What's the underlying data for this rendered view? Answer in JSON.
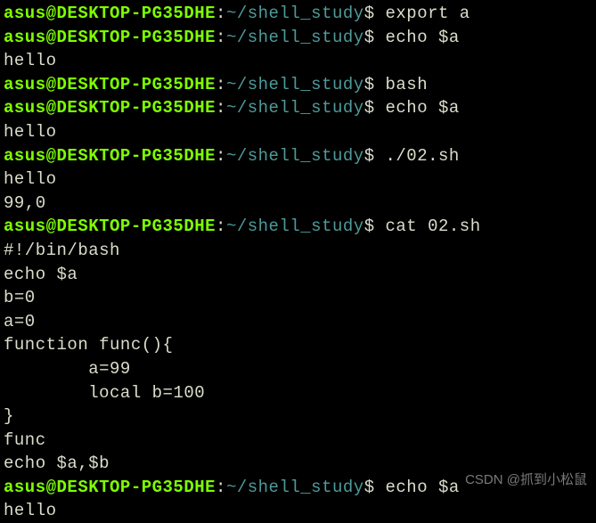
{
  "prompt": {
    "user_host": "asus@DESKTOP-PG35DHE",
    "colon": ":",
    "path": "~/shell_study",
    "dollar": "$"
  },
  "lines": [
    {
      "type": "prompt",
      "cmd": "export a"
    },
    {
      "type": "prompt",
      "cmd": "echo $a"
    },
    {
      "type": "output",
      "text": "hello"
    },
    {
      "type": "prompt",
      "cmd": "bash"
    },
    {
      "type": "prompt",
      "cmd": "echo $a"
    },
    {
      "type": "output",
      "text": "hello"
    },
    {
      "type": "prompt",
      "cmd": "./02.sh"
    },
    {
      "type": "output",
      "text": "hello"
    },
    {
      "type": "output",
      "text": "99,0"
    },
    {
      "type": "prompt",
      "cmd": "cat 02.sh"
    },
    {
      "type": "output",
      "text": "#!/bin/bash"
    },
    {
      "type": "output",
      "text": "echo $a"
    },
    {
      "type": "output",
      "text": "b=0"
    },
    {
      "type": "output",
      "text": "a=0"
    },
    {
      "type": "output",
      "text": "function func(){"
    },
    {
      "type": "output",
      "text": "        a=99"
    },
    {
      "type": "output",
      "text": "        local b=100"
    },
    {
      "type": "output",
      "text": "}"
    },
    {
      "type": "output",
      "text": "func"
    },
    {
      "type": "output",
      "text": "echo $a,$b"
    },
    {
      "type": "prompt",
      "cmd": "echo $a"
    },
    {
      "type": "output",
      "text": "hello"
    }
  ],
  "watermark": "CSDN @抓到小松鼠"
}
